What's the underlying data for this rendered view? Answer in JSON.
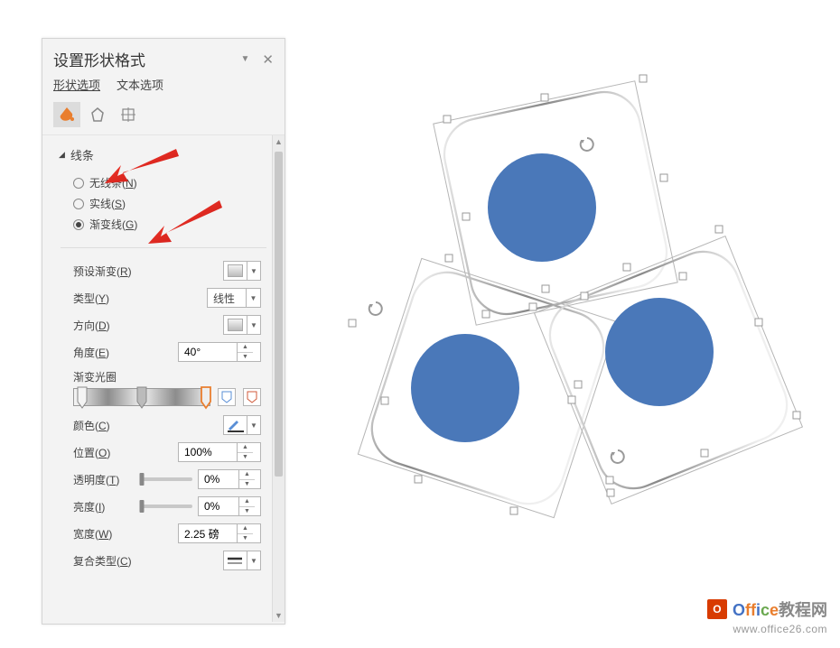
{
  "panel": {
    "title": "设置形状格式",
    "tabs": {
      "shape": "形状选项",
      "text": "文本选项"
    },
    "section_line": "线条",
    "radio_none": "无线条(",
    "radio_none_hot": "N",
    "radio_solid": "实线(",
    "radio_solid_hot": "S",
    "radio_gradient": "渐变线(",
    "radio_gradient_hot": "G",
    "preset": "预设渐变(",
    "preset_hot": "R",
    "type": "类型(",
    "type_hot": "Y",
    "type_value": "线性",
    "direction": "方向(",
    "direction_hot": "D",
    "angle": "角度(",
    "angle_hot": "E",
    "angle_value": "40°",
    "stops": "渐变光圈",
    "color": "颜色(",
    "color_hot": "C",
    "position": "位置(",
    "position_hot": "O",
    "position_value": "100%",
    "transparency": "透明度(",
    "transparency_hot": "T",
    "transparency_value": "0%",
    "brightness": "亮度(",
    "brightness_hot": "I",
    "brightness_value": "0%",
    "width": "宽度(",
    "width_hot": "W",
    "width_value": "2.25 磅",
    "compound": "复合类型(",
    "compound_hot": "C",
    "end_paren": ")"
  },
  "watermark": {
    "badge": "O",
    "line1a": "Office",
    "line1b": "教程网",
    "line2": "www.office26.com"
  }
}
